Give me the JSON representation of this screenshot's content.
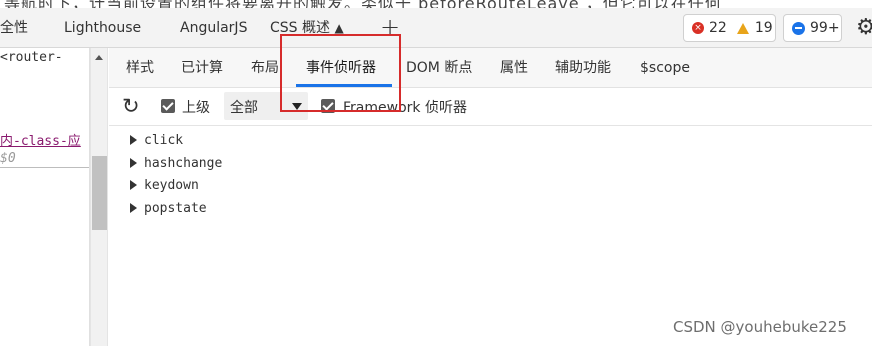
{
  "top_clip_text": "等航时下，计当前设置的组件将要离开的触发。类似于 beforeRouteLeave ，但它可以在任何",
  "main_tabs": [
    {
      "label": "全性"
    },
    {
      "label": "Lighthouse"
    },
    {
      "label": "AngularJS"
    },
    {
      "label": "CSS 概述"
    }
  ],
  "badges": {
    "errors": "22",
    "warnings": "19",
    "messages": "99+"
  },
  "left_code": {
    "line1": "<router-",
    "line2": "内-class-应",
    "line3": "$0"
  },
  "sub_tabs": [
    {
      "label": "样式"
    },
    {
      "label": "已计算"
    },
    {
      "label": "布局"
    },
    {
      "label": "事件侦听器"
    },
    {
      "label": "DOM 断点"
    },
    {
      "label": "属性"
    },
    {
      "label": "辅助功能"
    },
    {
      "label": "$scope"
    }
  ],
  "toolbar": {
    "ancestors_label": "上级",
    "ancestors_checked": true,
    "filter_value": "全部",
    "framework_label": "Framework 侦听器",
    "framework_checked": true
  },
  "events": [
    {
      "name": "click"
    },
    {
      "name": "hashchange"
    },
    {
      "name": "keydown"
    },
    {
      "name": "popstate"
    }
  ],
  "watermark": "CSDN @youhebuke225",
  "colors": {
    "accent": "#1a73e8",
    "error": "#d93025",
    "warning": "#e8a41a",
    "highlight_box": "#d62b2b"
  }
}
